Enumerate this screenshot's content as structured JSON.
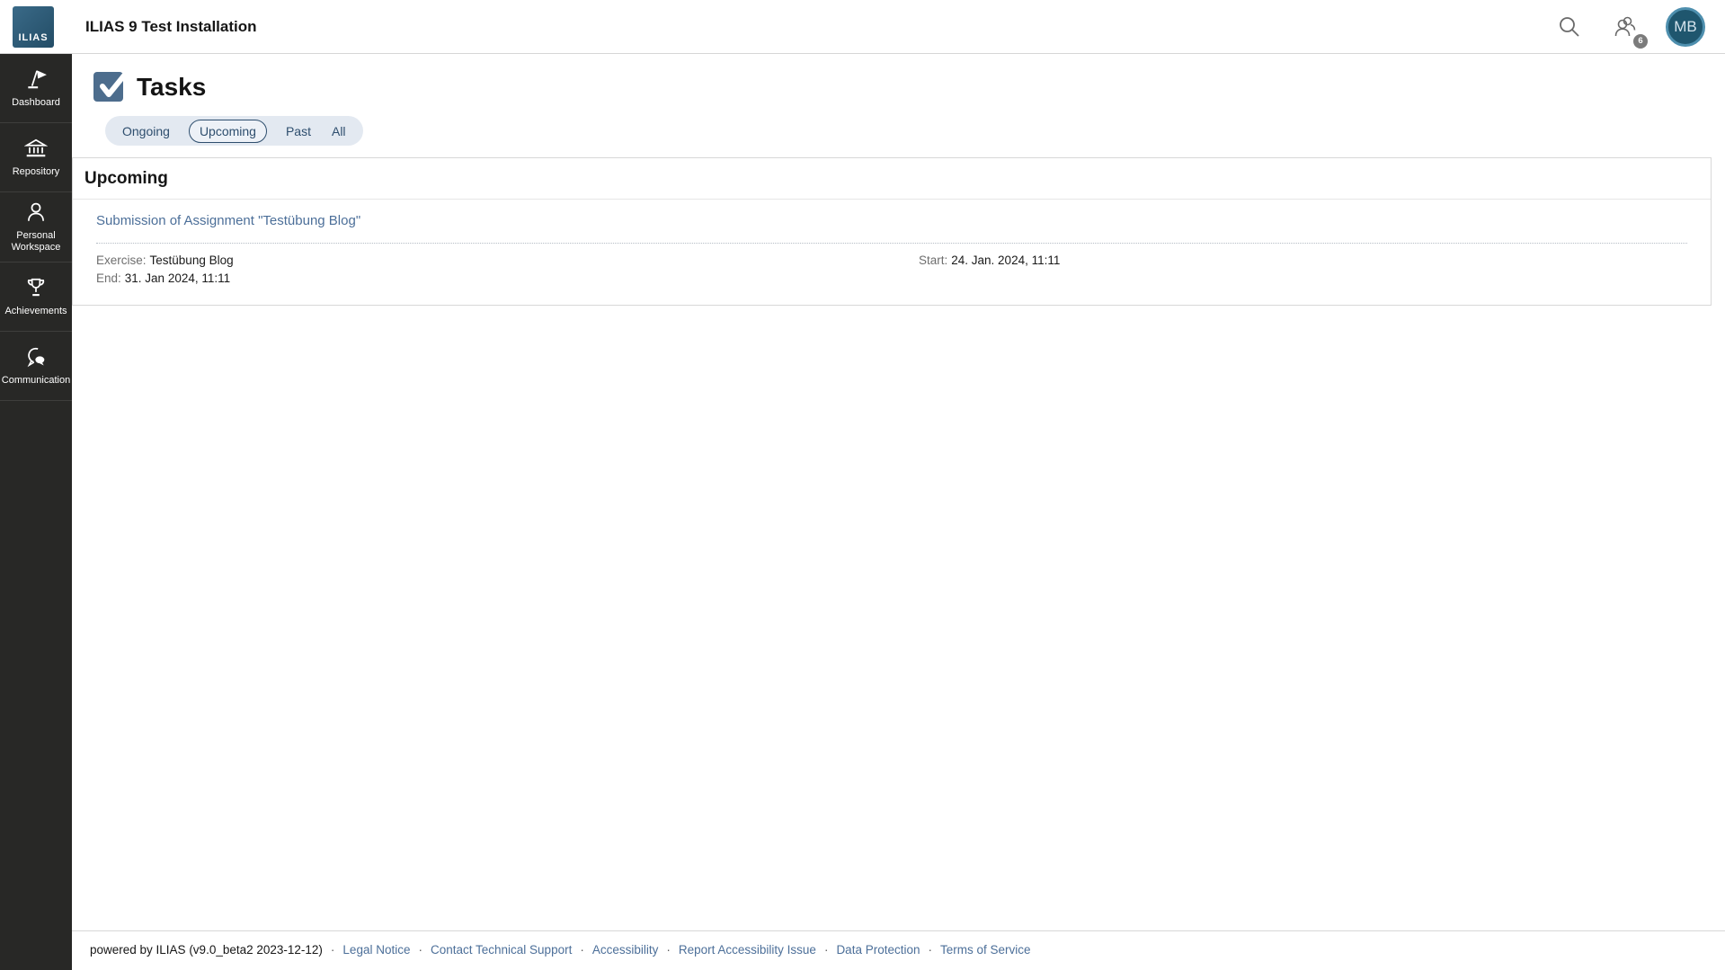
{
  "topbar": {
    "logo_text": "ILIAS",
    "title": "ILIAS 9 Test Installation",
    "user_badge_count": "6",
    "avatar_initials": "MB"
  },
  "sidebar": {
    "items": [
      {
        "label": "Dashboard",
        "icon": "dashboard-icon"
      },
      {
        "label": "Repository",
        "icon": "repository-icon"
      },
      {
        "label": "Personal Workspace",
        "icon": "personal-workspace-icon"
      },
      {
        "label": "Achievements",
        "icon": "achievements-icon"
      },
      {
        "label": "Communication",
        "icon": "communication-icon"
      }
    ]
  },
  "page": {
    "title": "Tasks",
    "tabs": [
      {
        "label": "Ongoing",
        "active": false
      },
      {
        "label": "Upcoming",
        "active": true
      },
      {
        "label": "Past",
        "active": false
      },
      {
        "label": "All",
        "active": false
      }
    ]
  },
  "panel": {
    "header": "Upcoming",
    "task": {
      "title": "Submission of Assignment \"Testübung Blog\"",
      "exercise_label": "Exercise:",
      "exercise_value": "Testübung Blog",
      "start_label": "Start:",
      "start_value": "24. Jan. 2024, 11:11",
      "end_label": "End:",
      "end_value": "31. Jan 2024, 11:11"
    }
  },
  "footer": {
    "powered_by": "powered by ILIAS (v9.0_beta2 2023-12-12)",
    "separator": "·",
    "links": [
      "Legal Notice",
      "Contact Technical Support",
      "Accessibility",
      "Report Accessibility Issue",
      "Data Protection",
      "Terms of Service"
    ]
  },
  "colors": {
    "accent_link": "#4c6f99",
    "tab_text": "#2e4e6e",
    "sidebar_bg": "#282826",
    "tasks_icon_bg": "#4d6d8d",
    "avatar_bg": "#1f566e",
    "avatar_ring": "#4e8fae",
    "badge_bg": "#7b7b7b"
  }
}
